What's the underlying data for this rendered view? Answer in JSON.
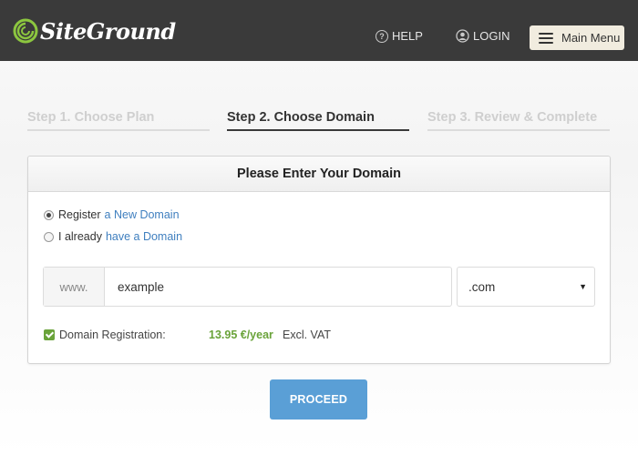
{
  "header": {
    "logo_text": "SiteGround",
    "help_label": "HELP",
    "login_label": "LOGIN",
    "menu_label": "Main Menu"
  },
  "steps": [
    {
      "label": "Step 1. Choose Plan",
      "state": "inactive"
    },
    {
      "label": "Step 2. Choose Domain",
      "state": "active"
    },
    {
      "label": "Step 3. Review & Complete",
      "state": "inactive"
    }
  ],
  "card": {
    "title": "Please Enter Your Domain",
    "options": [
      {
        "prefix": "Register",
        "link": "a New Domain",
        "checked": true
      },
      {
        "prefix": "I already",
        "link": "have a Domain",
        "checked": false
      }
    ],
    "domain": {
      "prefix": "www.",
      "value": "example",
      "tld": ".com"
    },
    "registration": {
      "label": "Domain Registration:",
      "checked": true,
      "price": "13.95 €/year",
      "vat": "Excl. VAT"
    }
  },
  "proceed_label": "PROCEED",
  "colors": {
    "header_bg": "#3a3a3a",
    "link": "#3f7fbf",
    "green": "#6aa33a",
    "button": "#5a9fd6"
  }
}
